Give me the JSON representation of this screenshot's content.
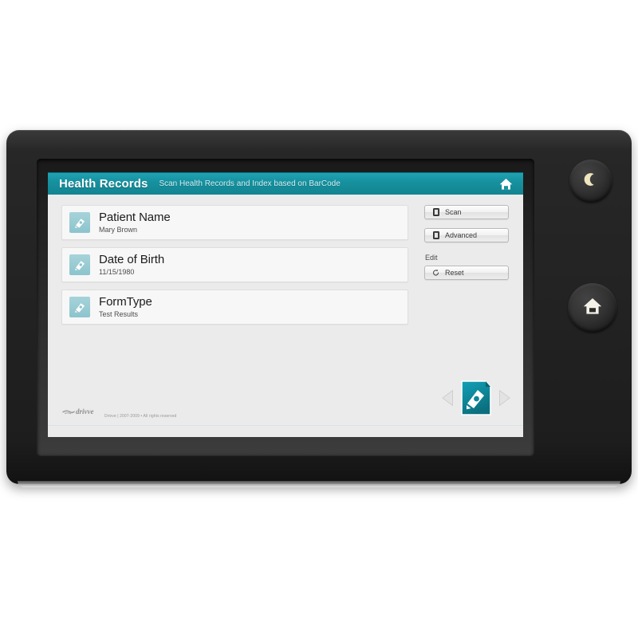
{
  "device": {
    "sleep_button_icon": "crescent-moon-icon",
    "home_button_icon": "home-icon"
  },
  "header": {
    "title": "Health Records",
    "subtitle": "Scan Health Records and Index based on BarCode",
    "home_icon": "home-icon"
  },
  "records": [
    {
      "icon": "scan-document-icon",
      "label": "Patient Name",
      "value": "Mary Brown"
    },
    {
      "icon": "scan-document-icon",
      "label": "Date of Birth",
      "value": "11/15/1980"
    },
    {
      "icon": "scan-document-icon",
      "label": "FormType",
      "value": "Test Results"
    }
  ],
  "actions": {
    "scan_label": "Scan",
    "scan_icon": "scanner-icon",
    "advanced_label": "Advanced",
    "advanced_icon": "scanner-icon",
    "edit_section_label": "Edit",
    "reset_label": "Reset",
    "reset_icon": "refresh-arrow-icon"
  },
  "footer": {
    "logo_text": "drivve",
    "copyright": "Drivve | 2007-2009 • All rights reserved"
  },
  "pager": {
    "prev_icon": "triangle-left-icon",
    "next_icon": "triangle-right-icon",
    "center_icon": "scan-document-icon"
  },
  "colors": {
    "accent_teal": "#17919f",
    "screen_background": "#ebebeb",
    "row_background": "#f7f7f7",
    "record_icon_teal": "#8cc4cd",
    "pager_icon_teal": "#128da0"
  }
}
